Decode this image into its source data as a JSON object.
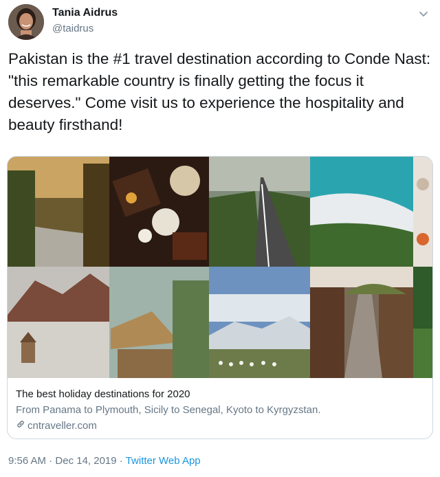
{
  "author": {
    "name": "Tania Aidrus",
    "handle": "@taidrus"
  },
  "tweet": {
    "text": "Pakistan is the #1 travel destination according to Conde Nast: \"this remarkable country is finally getting the focus it deserves.\" Come visit us to experience the hospitality and beauty firsthand!"
  },
  "card": {
    "title": "The best holiday destinations for 2020",
    "description": "From Panama to Plymouth, Sicily to Senegal, Kyoto to Kyrgyzstan.",
    "domain": "cntraveller.com"
  },
  "footer": {
    "time": "9:56 AM",
    "separator1": " · ",
    "date": "Dec 14, 2019",
    "separator2": " · ",
    "app": "Twitter Web App"
  },
  "colors": {
    "link": "#1b95e0",
    "secondary": "#657786",
    "border": "#ccd6dd"
  },
  "icons": {
    "caret": "chevron-down-icon",
    "link": "link-icon"
  }
}
